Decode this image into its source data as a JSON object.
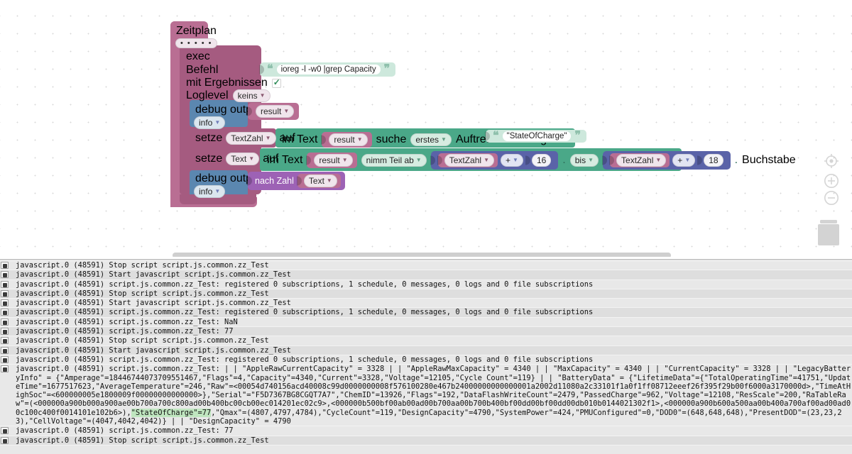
{
  "workspace": {
    "schedule_block": {
      "title": "Zeitplan",
      "cron_field": "• • • • •"
    },
    "exec_block": {
      "label": "exec",
      "command_label": "Befehl",
      "command_value": "ioreg -l -w0 |grep Capacity",
      "results_label": "mit Ergebnissen",
      "results_checked": "checked",
      "loglevel_label": "Loglevel",
      "loglevel_value": "keins"
    },
    "debug_block_1": {
      "label": "debug output",
      "severity": "info",
      "value": "result"
    },
    "set_textzahl_block": {
      "set_label": "setze",
      "variable": "TextZahl",
      "to_label": "auf",
      "in_text_label": "im Text",
      "text_value": "result",
      "search_label": "suche",
      "occurrence": "erstes",
      "occurrence_suffix": "Auftreten des Begriffs",
      "needle": "\"StateOfCharge\""
    },
    "set_text_block": {
      "set_label": "setze",
      "variable": "Text",
      "to_label": "auf",
      "in_text_label": "im Text",
      "text_value": "result",
      "substring_label": "nimm Teil ab",
      "from_variable": "TextZahl",
      "from_op": "+",
      "from_offset": "16",
      "to_label_2": "bis",
      "to_variable": "TextZahl",
      "to_op": "+",
      "to_offset": "18",
      "unit_label": "Buchstabe"
    },
    "debug_block_2": {
      "label": "debug output",
      "severity": "info",
      "convert_label": "nach Zahl",
      "value": "Text"
    },
    "controls": {
      "center_icon": "center-target-icon",
      "zoom_in_icon": "zoom-in-icon",
      "zoom_out_icon": "zoom-out-icon",
      "trash_icon": "trash-icon"
    }
  },
  "log": {
    "rows": [
      {
        "alt": false,
        "gutter": true,
        "text": "javascript.0 (48591) Stop script script.js.common.zz_Test"
      },
      {
        "alt": true,
        "gutter": true,
        "text": "javascript.0 (48591) Start javascript script.js.common.zz_Test"
      },
      {
        "alt": false,
        "gutter": true,
        "text": "javascript.0 (48591) script.js.common.zz_Test: registered 0 subscriptions, 1 schedule, 0 messages, 0 logs and 0 file subscriptions"
      },
      {
        "alt": true,
        "gutter": true,
        "text": "javascript.0 (48591) Stop script script.js.common.zz_Test"
      },
      {
        "alt": false,
        "gutter": true,
        "text": "javascript.0 (48591) Start javascript script.js.common.zz_Test"
      },
      {
        "alt": true,
        "gutter": true,
        "text": "javascript.0 (48591) script.js.common.zz_Test: registered 0 subscriptions, 1 schedule, 0 messages, 0 logs and 0 file subscriptions"
      },
      {
        "alt": false,
        "gutter": true,
        "text": "javascript.0 (48591) script.js.common.zz_Test: NaN"
      },
      {
        "alt": true,
        "gutter": true,
        "text": "javascript.0 (48591) script.js.common.zz_Test: 77"
      },
      {
        "alt": false,
        "gutter": true,
        "text": "javascript.0 (48591) Stop script script.js.common.zz_Test"
      },
      {
        "alt": true,
        "gutter": true,
        "text": "javascript.0 (48591) Start javascript script.js.common.zz_Test"
      },
      {
        "alt": false,
        "gutter": true,
        "text": "javascript.0 (48591) script.js.common.zz_Test: registered 0 subscriptions, 1 schedule, 0 messages, 0 logs and 0 file subscriptions"
      }
    ],
    "big_entry": {
      "gutter": true,
      "segments": [
        {
          "hl": false,
          "text": "javascript.0 (48591) script.js.common.zz_Test: | | \"AppleRawCurrentCapacity\" = 3328 | | \"AppleRawMaxCapacity\" = 4340 | | \"MaxCapacity\" = 4340 | | \"CurrentCapacity\" = 3328 | | \"LegacyBatteryInfo\" = {\"Amperage\"=18446744073709551467,\"Flags\"=4,\"Capacity\"=4340,\"Current\"=3328,\"Voltage\"=12105,\"Cycle Count\"=119} | | \"BatteryData\" = {\"LifetimeData\"={\"TotalOperatingTime\"=41751,\"UpdateTime\"=1677517623,\"AverageTemperature\"=246,\"Raw\"=<00054d740156acd40008c99d0000000008f576100280e467b24000000000000001a2002d11080a2c33101f1a0f1ff08712eeef26f395f29b00f6000a3170000d>,\"TimeAtHighSoc\"=<600000005e1800009f00000000000000>},\"Serial\"=\"F5D7367BG8CGQT7A7\",\"ChemID\"=13926,\"Flags\"=192,\"DataFlashWriteCount\"=2479,\"PassedCharge\"=962,\"Voltage\"=12108,\"ResScale\"=200,\"RaTableRaw\"=(<000000a900b000a900ae00b700a700c800ad00b400bc00cb00ec014201ec02c9>,<000000b500bf00ab00ad00b700aa00b700b400bf00dd00bf00dd00db010b0144021302f1>,<000000a900b600a500aa00b400a700af00ad00ad00c100c400f0014101e102b6>),"
        },
        {
          "hl": true,
          "text": "\"StateOfCharge\"=77"
        },
        {
          "hl": false,
          "text": ",\"Qmax\"=(4807,4797,4784),\"CycleCount\"=119,\"DesignCapacity\"=4790,\"SystemPower\"=424,\"PMUConfigured\"=0,\"DOD0\"=(648,648,648),\"PresentDOD\"=(23,23,23),\"CellVoltage\"=(4047,4042,4042)} | | \"DesignCapacity\" = 4790"
        }
      ]
    },
    "tail_rows": [
      {
        "alt": false,
        "gutter": true,
        "text": "javascript.0 (48591) script.js.common.zz_Test: 77"
      },
      {
        "alt": true,
        "gutter": true,
        "text": "javascript.0 (48591) Stop script script.js.common.zz_Test"
      }
    ]
  }
}
